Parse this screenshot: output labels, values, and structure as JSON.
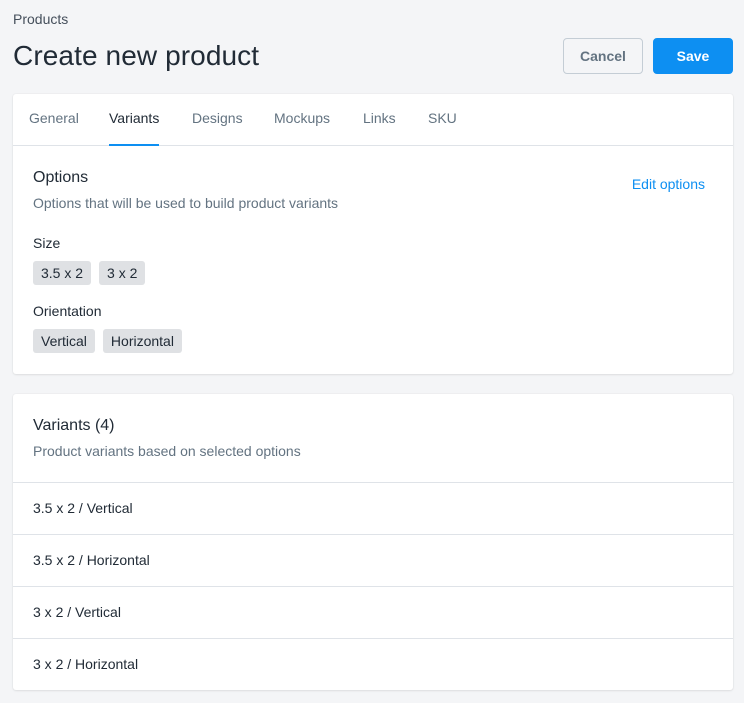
{
  "breadcrumb": "Products",
  "page_title": "Create new product",
  "actions": {
    "cancel_label": "Cancel",
    "save_label": "Save"
  },
  "tabs": [
    {
      "label": "General",
      "active": false
    },
    {
      "label": "Variants",
      "active": true
    },
    {
      "label": "Designs",
      "active": false
    },
    {
      "label": "Mockups",
      "active": false
    },
    {
      "label": "Links",
      "active": false
    },
    {
      "label": "SKU",
      "active": false
    }
  ],
  "options": {
    "title": "Options",
    "subtitle": "Options that will be used to build product variants",
    "edit_label": "Edit options",
    "groups": [
      {
        "label": "Size",
        "values": [
          "3.5 x 2",
          "3 x 2"
        ]
      },
      {
        "label": "Orientation",
        "values": [
          "Vertical",
          "Horizontal"
        ]
      }
    ]
  },
  "variants": {
    "title": "Variants (4)",
    "subtitle": "Product variants based on selected options",
    "rows": [
      "3.5 x 2 / Vertical",
      "3.5 x 2 / Horizontal",
      "3 x 2 / Vertical",
      "3 x 2 / Horizontal"
    ]
  },
  "colors": {
    "accent": "#0d8ff2",
    "chip_bg": "#dfe1e4",
    "page_bg": "#f4f5f7"
  }
}
